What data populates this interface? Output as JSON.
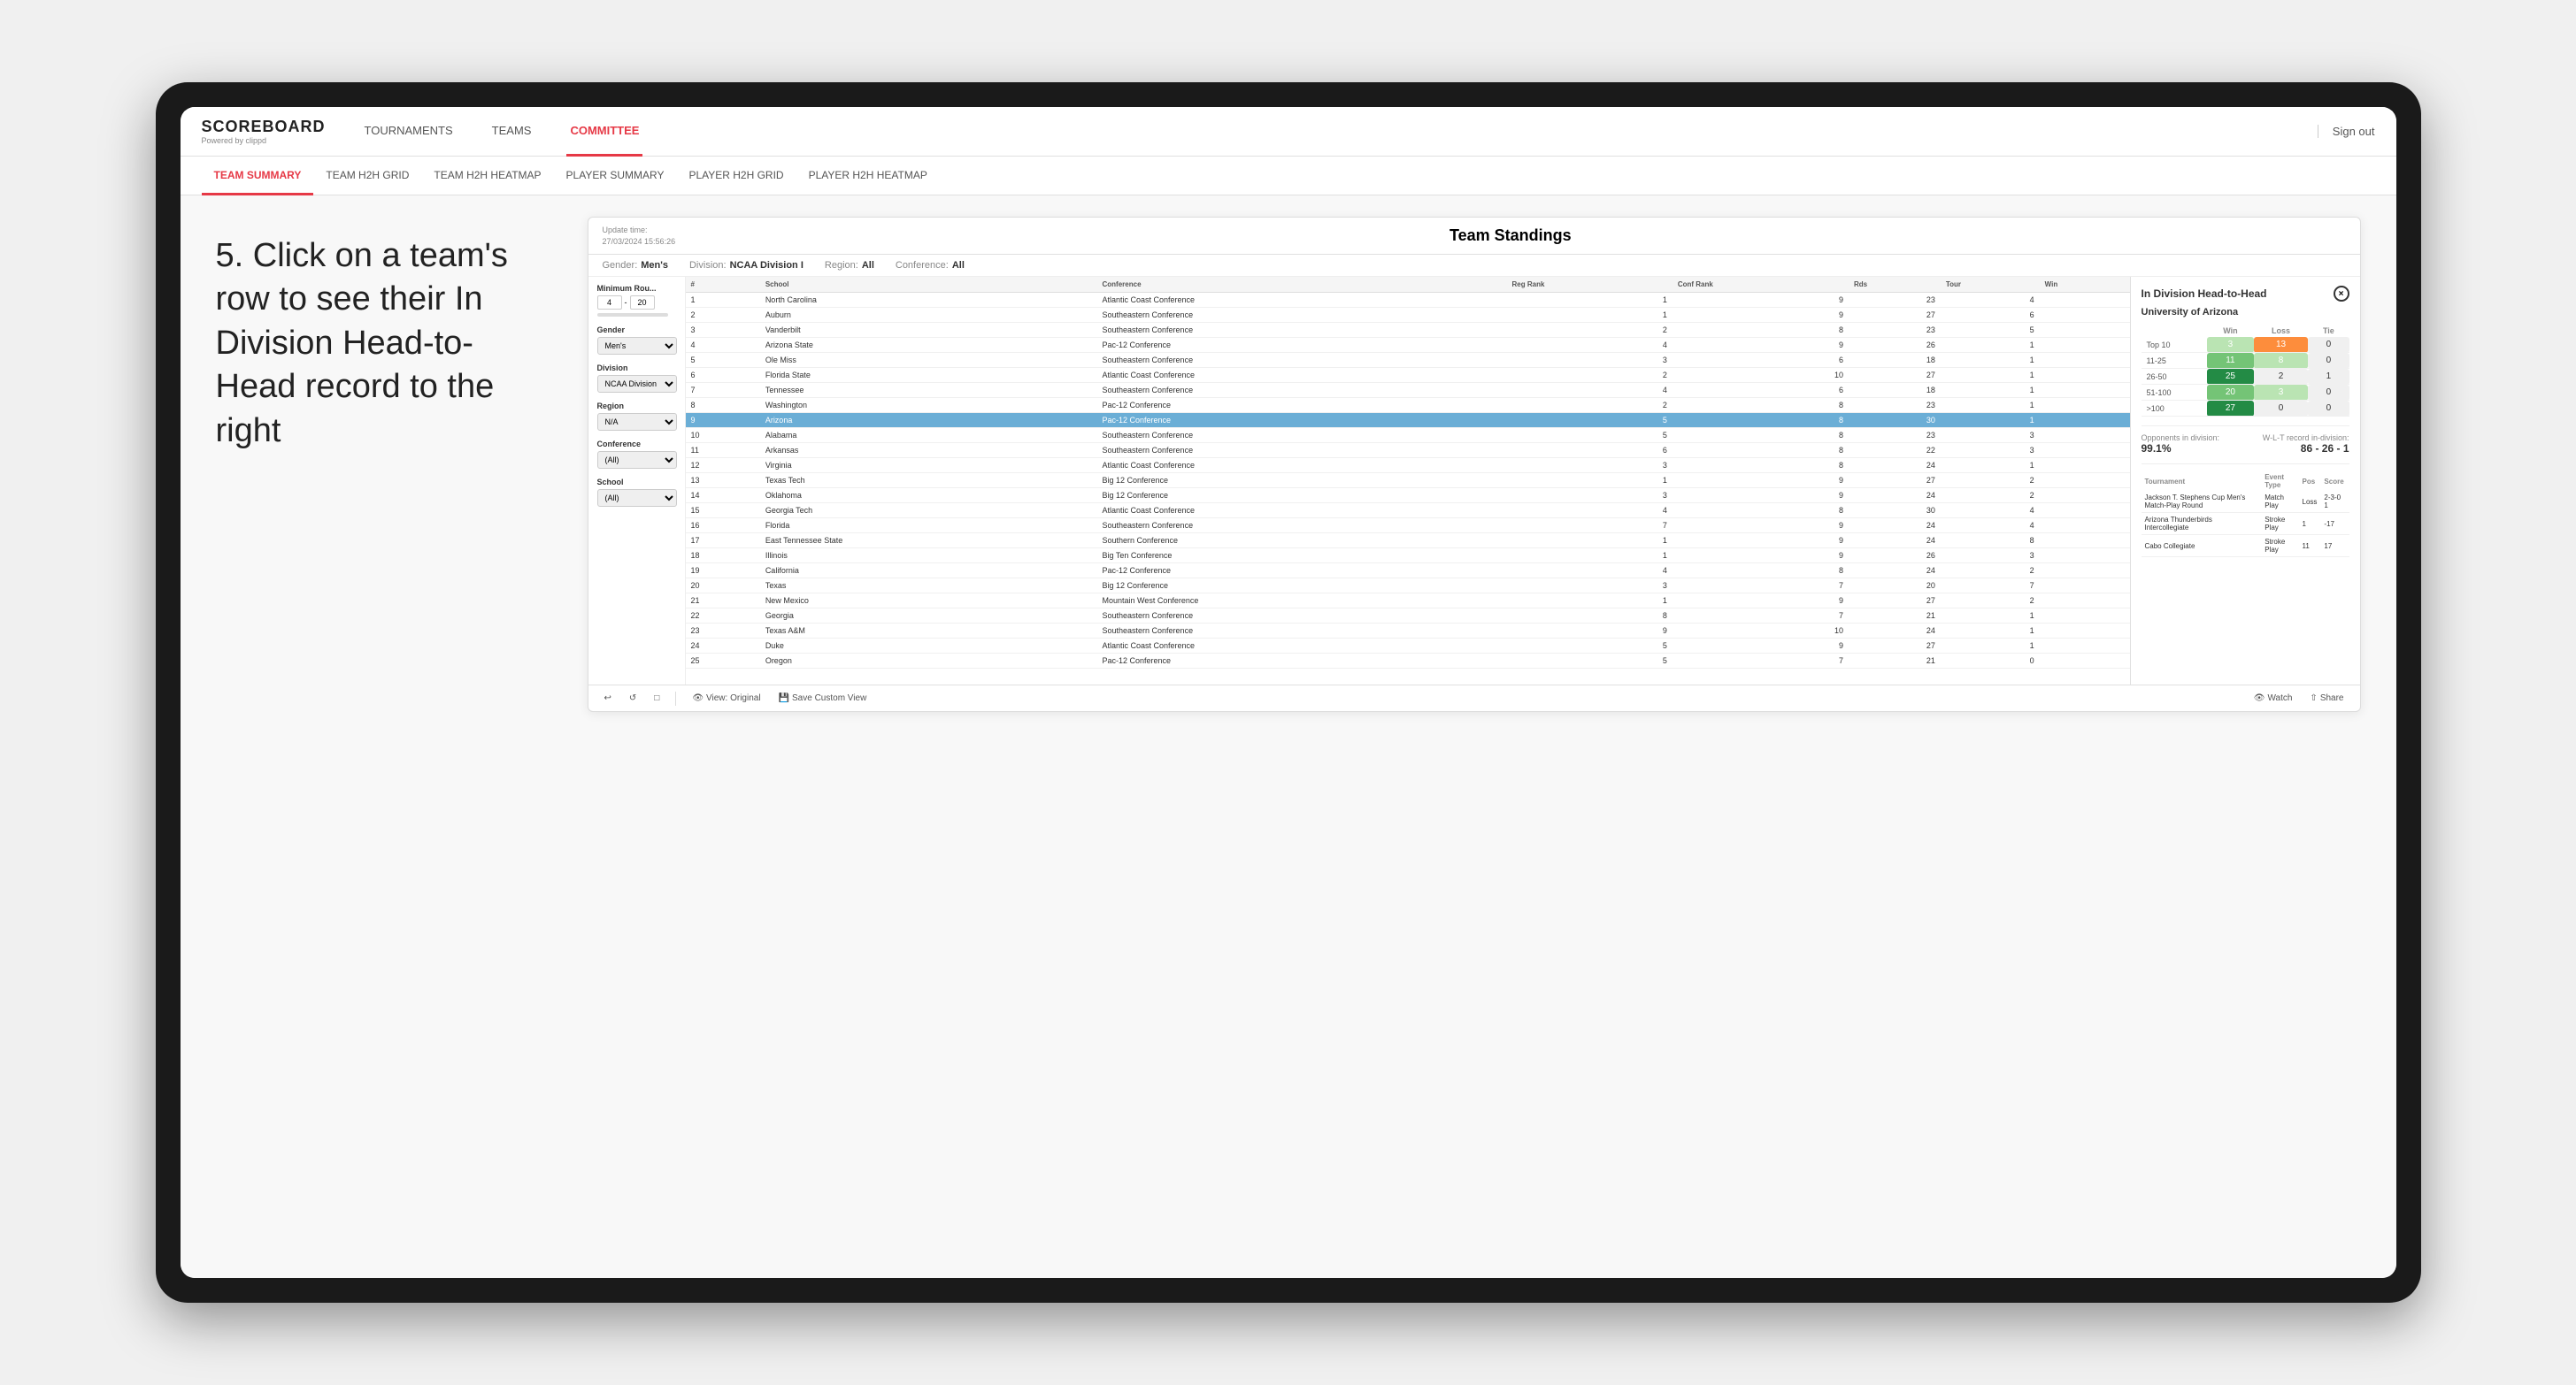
{
  "device": {
    "type": "tablet"
  },
  "annotation": {
    "text": "5. Click on a team's row to see their In Division Head-to-Head record to the right"
  },
  "topNav": {
    "logo": "SCOREBOARD",
    "logoSub": "Powered by clippd",
    "items": [
      {
        "label": "TOURNAMENTS",
        "active": false
      },
      {
        "label": "TEAMS",
        "active": false
      },
      {
        "label": "COMMITTEE",
        "active": true
      }
    ],
    "signOut": "Sign out"
  },
  "subNav": {
    "items": [
      {
        "label": "TEAM SUMMARY",
        "active": true
      },
      {
        "label": "TEAM H2H GRID",
        "active": false
      },
      {
        "label": "TEAM H2H HEATMAP",
        "active": false
      },
      {
        "label": "PLAYER SUMMARY",
        "active": false
      },
      {
        "label": "PLAYER H2H GRID",
        "active": false
      },
      {
        "label": "PLAYER H2H HEATMAP",
        "active": false
      }
    ]
  },
  "window": {
    "updateLabel": "Update time:",
    "updateTime": "27/03/2024 15:56:26",
    "title": "Team Standings",
    "filters": {
      "gender": {
        "label": "Gender:",
        "value": "Men's"
      },
      "division": {
        "label": "Division:",
        "value": "NCAA Division I"
      },
      "region": {
        "label": "Region:",
        "value": "All"
      },
      "conference": {
        "label": "Conference:",
        "value": "All"
      }
    }
  },
  "leftFilters": {
    "minRounds": {
      "label": "Minimum Rou...",
      "min": 4,
      "max": 20
    },
    "gender": {
      "label": "Gender",
      "value": "Men's"
    },
    "division": {
      "label": "Division",
      "value": "NCAA Division I"
    },
    "region": {
      "label": "Region",
      "value": "N/A"
    },
    "conference": {
      "label": "Conference",
      "value": "(All)"
    },
    "school": {
      "label": "School",
      "value": "(All)"
    }
  },
  "tableColumns": [
    "#",
    "School",
    "Conference",
    "Reg Rank",
    "Conf Rank",
    "Rds",
    "Tour",
    "Win"
  ],
  "tableRows": [
    {
      "rank": 1,
      "school": "North Carolina",
      "conference": "Atlantic Coast Conference",
      "regRank": 1,
      "confRank": 9,
      "rds": 23,
      "tour": 4,
      "win": ""
    },
    {
      "rank": 2,
      "school": "Auburn",
      "conference": "Southeastern Conference",
      "regRank": 1,
      "confRank": 9,
      "rds": 27,
      "tour": 6,
      "win": ""
    },
    {
      "rank": 3,
      "school": "Vanderbilt",
      "conference": "Southeastern Conference",
      "regRank": 2,
      "confRank": 8,
      "rds": 23,
      "tour": 5,
      "win": ""
    },
    {
      "rank": 4,
      "school": "Arizona State",
      "conference": "Pac-12 Conference",
      "regRank": 4,
      "confRank": 9,
      "rds": 26,
      "tour": 1,
      "win": ""
    },
    {
      "rank": 5,
      "school": "Ole Miss",
      "conference": "Southeastern Conference",
      "regRank": 3,
      "confRank": 6,
      "rds": 18,
      "tour": 1,
      "win": ""
    },
    {
      "rank": 6,
      "school": "Florida State",
      "conference": "Atlantic Coast Conference",
      "regRank": 2,
      "confRank": 10,
      "rds": 27,
      "tour": 1,
      "win": ""
    },
    {
      "rank": 7,
      "school": "Tennessee",
      "conference": "Southeastern Conference",
      "regRank": 4,
      "confRank": 6,
      "rds": 18,
      "tour": 1,
      "win": ""
    },
    {
      "rank": 8,
      "school": "Washington",
      "conference": "Pac-12 Conference",
      "regRank": 2,
      "confRank": 8,
      "rds": 23,
      "tour": 1,
      "win": ""
    },
    {
      "rank": 9,
      "school": "Arizona",
      "conference": "Pac-12 Conference",
      "regRank": 5,
      "confRank": 8,
      "rds": 30,
      "tour": 1,
      "win": "",
      "selected": true
    },
    {
      "rank": 10,
      "school": "Alabama",
      "conference": "Southeastern Conference",
      "regRank": 5,
      "confRank": 8,
      "rds": 23,
      "tour": 3,
      "win": ""
    },
    {
      "rank": 11,
      "school": "Arkansas",
      "conference": "Southeastern Conference",
      "regRank": 6,
      "confRank": 8,
      "rds": 22,
      "tour": 3,
      "win": ""
    },
    {
      "rank": 12,
      "school": "Virginia",
      "conference": "Atlantic Coast Conference",
      "regRank": 3,
      "confRank": 8,
      "rds": 24,
      "tour": 1,
      "win": ""
    },
    {
      "rank": 13,
      "school": "Texas Tech",
      "conference": "Big 12 Conference",
      "regRank": 1,
      "confRank": 9,
      "rds": 27,
      "tour": 2,
      "win": ""
    },
    {
      "rank": 14,
      "school": "Oklahoma",
      "conference": "Big 12 Conference",
      "regRank": 3,
      "confRank": 9,
      "rds": 24,
      "tour": 2,
      "win": ""
    },
    {
      "rank": 15,
      "school": "Georgia Tech",
      "conference": "Atlantic Coast Conference",
      "regRank": 4,
      "confRank": 8,
      "rds": 30,
      "tour": 4,
      "win": ""
    },
    {
      "rank": 16,
      "school": "Florida",
      "conference": "Southeastern Conference",
      "regRank": 7,
      "confRank": 9,
      "rds": 24,
      "tour": 4,
      "win": ""
    },
    {
      "rank": 17,
      "school": "East Tennessee State",
      "conference": "Southern Conference",
      "regRank": 1,
      "confRank": 9,
      "rds": 24,
      "tour": 8,
      "win": ""
    },
    {
      "rank": 18,
      "school": "Illinois",
      "conference": "Big Ten Conference",
      "regRank": 1,
      "confRank": 9,
      "rds": 26,
      "tour": 3,
      "win": ""
    },
    {
      "rank": 19,
      "school": "California",
      "conference": "Pac-12 Conference",
      "regRank": 4,
      "confRank": 8,
      "rds": 24,
      "tour": 2,
      "win": ""
    },
    {
      "rank": 20,
      "school": "Texas",
      "conference": "Big 12 Conference",
      "regRank": 3,
      "confRank": 7,
      "rds": 20,
      "tour": 7,
      "win": ""
    },
    {
      "rank": 21,
      "school": "New Mexico",
      "conference": "Mountain West Conference",
      "regRank": 1,
      "confRank": 9,
      "rds": 27,
      "tour": 2,
      "win": ""
    },
    {
      "rank": 22,
      "school": "Georgia",
      "conference": "Southeastern Conference",
      "regRank": 8,
      "confRank": 7,
      "rds": 21,
      "tour": 1,
      "win": ""
    },
    {
      "rank": 23,
      "school": "Texas A&M",
      "conference": "Southeastern Conference",
      "regRank": 9,
      "confRank": 10,
      "rds": 24,
      "tour": 1,
      "win": ""
    },
    {
      "rank": 24,
      "school": "Duke",
      "conference": "Atlantic Coast Conference",
      "regRank": 5,
      "confRank": 9,
      "rds": 27,
      "tour": 1,
      "win": ""
    },
    {
      "rank": 25,
      "school": "Oregon",
      "conference": "Pac-12 Conference",
      "regRank": 5,
      "confRank": 7,
      "rds": 21,
      "tour": 0,
      "win": ""
    }
  ],
  "rightPanel": {
    "title": "In Division Head-to-Head",
    "teamName": "University of Arizona",
    "closeBtn": "×",
    "gridHeaders": [
      "",
      "Win",
      "Loss",
      "Tie"
    ],
    "gridRows": [
      {
        "range": "Top 10",
        "win": 3,
        "loss": 13,
        "tie": 0,
        "winColor": "green-light",
        "lossColor": "orange"
      },
      {
        "range": "11-25",
        "win": 11,
        "loss": 8,
        "tie": 0,
        "winColor": "green-mid",
        "lossColor": "green-light"
      },
      {
        "range": "26-50",
        "win": 25,
        "loss": 2,
        "tie": 1,
        "winColor": "green-dark",
        "lossColor": "neutral"
      },
      {
        "range": "51-100",
        "win": 20,
        "loss": 3,
        "tie": 0,
        "winColor": "green-mid",
        "lossColor": "green-light"
      },
      {
        "range": ">100",
        "win": 27,
        "loss": 0,
        "tie": 0,
        "winColor": "green-dark",
        "lossColor": "neutral"
      }
    ],
    "opponents": {
      "label": "Opponents in division:",
      "value": "99.1%"
    },
    "record": {
      "label": "W-L-T record in-division:",
      "value": "86 - 26 - 1"
    },
    "tournamentLabel": "Tournament",
    "eventTypeLabel": "Event Type",
    "posLabel": "Pos",
    "scoreLabel": "Score",
    "tournaments": [
      {
        "name": "Jackson T. Stephens Cup Men's Match-Play Round",
        "eventType": "Match Play",
        "pos": "Loss",
        "score": "2-3-0 1"
      },
      {
        "name": "Arizona Thunderbirds Intercollegiate",
        "eventType": "Stroke Play",
        "pos": "1",
        "score": "-17"
      },
      {
        "name": "Cabo Collegiate",
        "eventType": "Stroke Play",
        "pos": "11",
        "score": "17"
      }
    ]
  },
  "toolbar": {
    "undo": "↩",
    "redo": "↪",
    "copy": "⧉",
    "viewOriginal": "View: Original",
    "saveCustomView": "Save Custom View",
    "watch": "Watch",
    "share": "Share"
  }
}
